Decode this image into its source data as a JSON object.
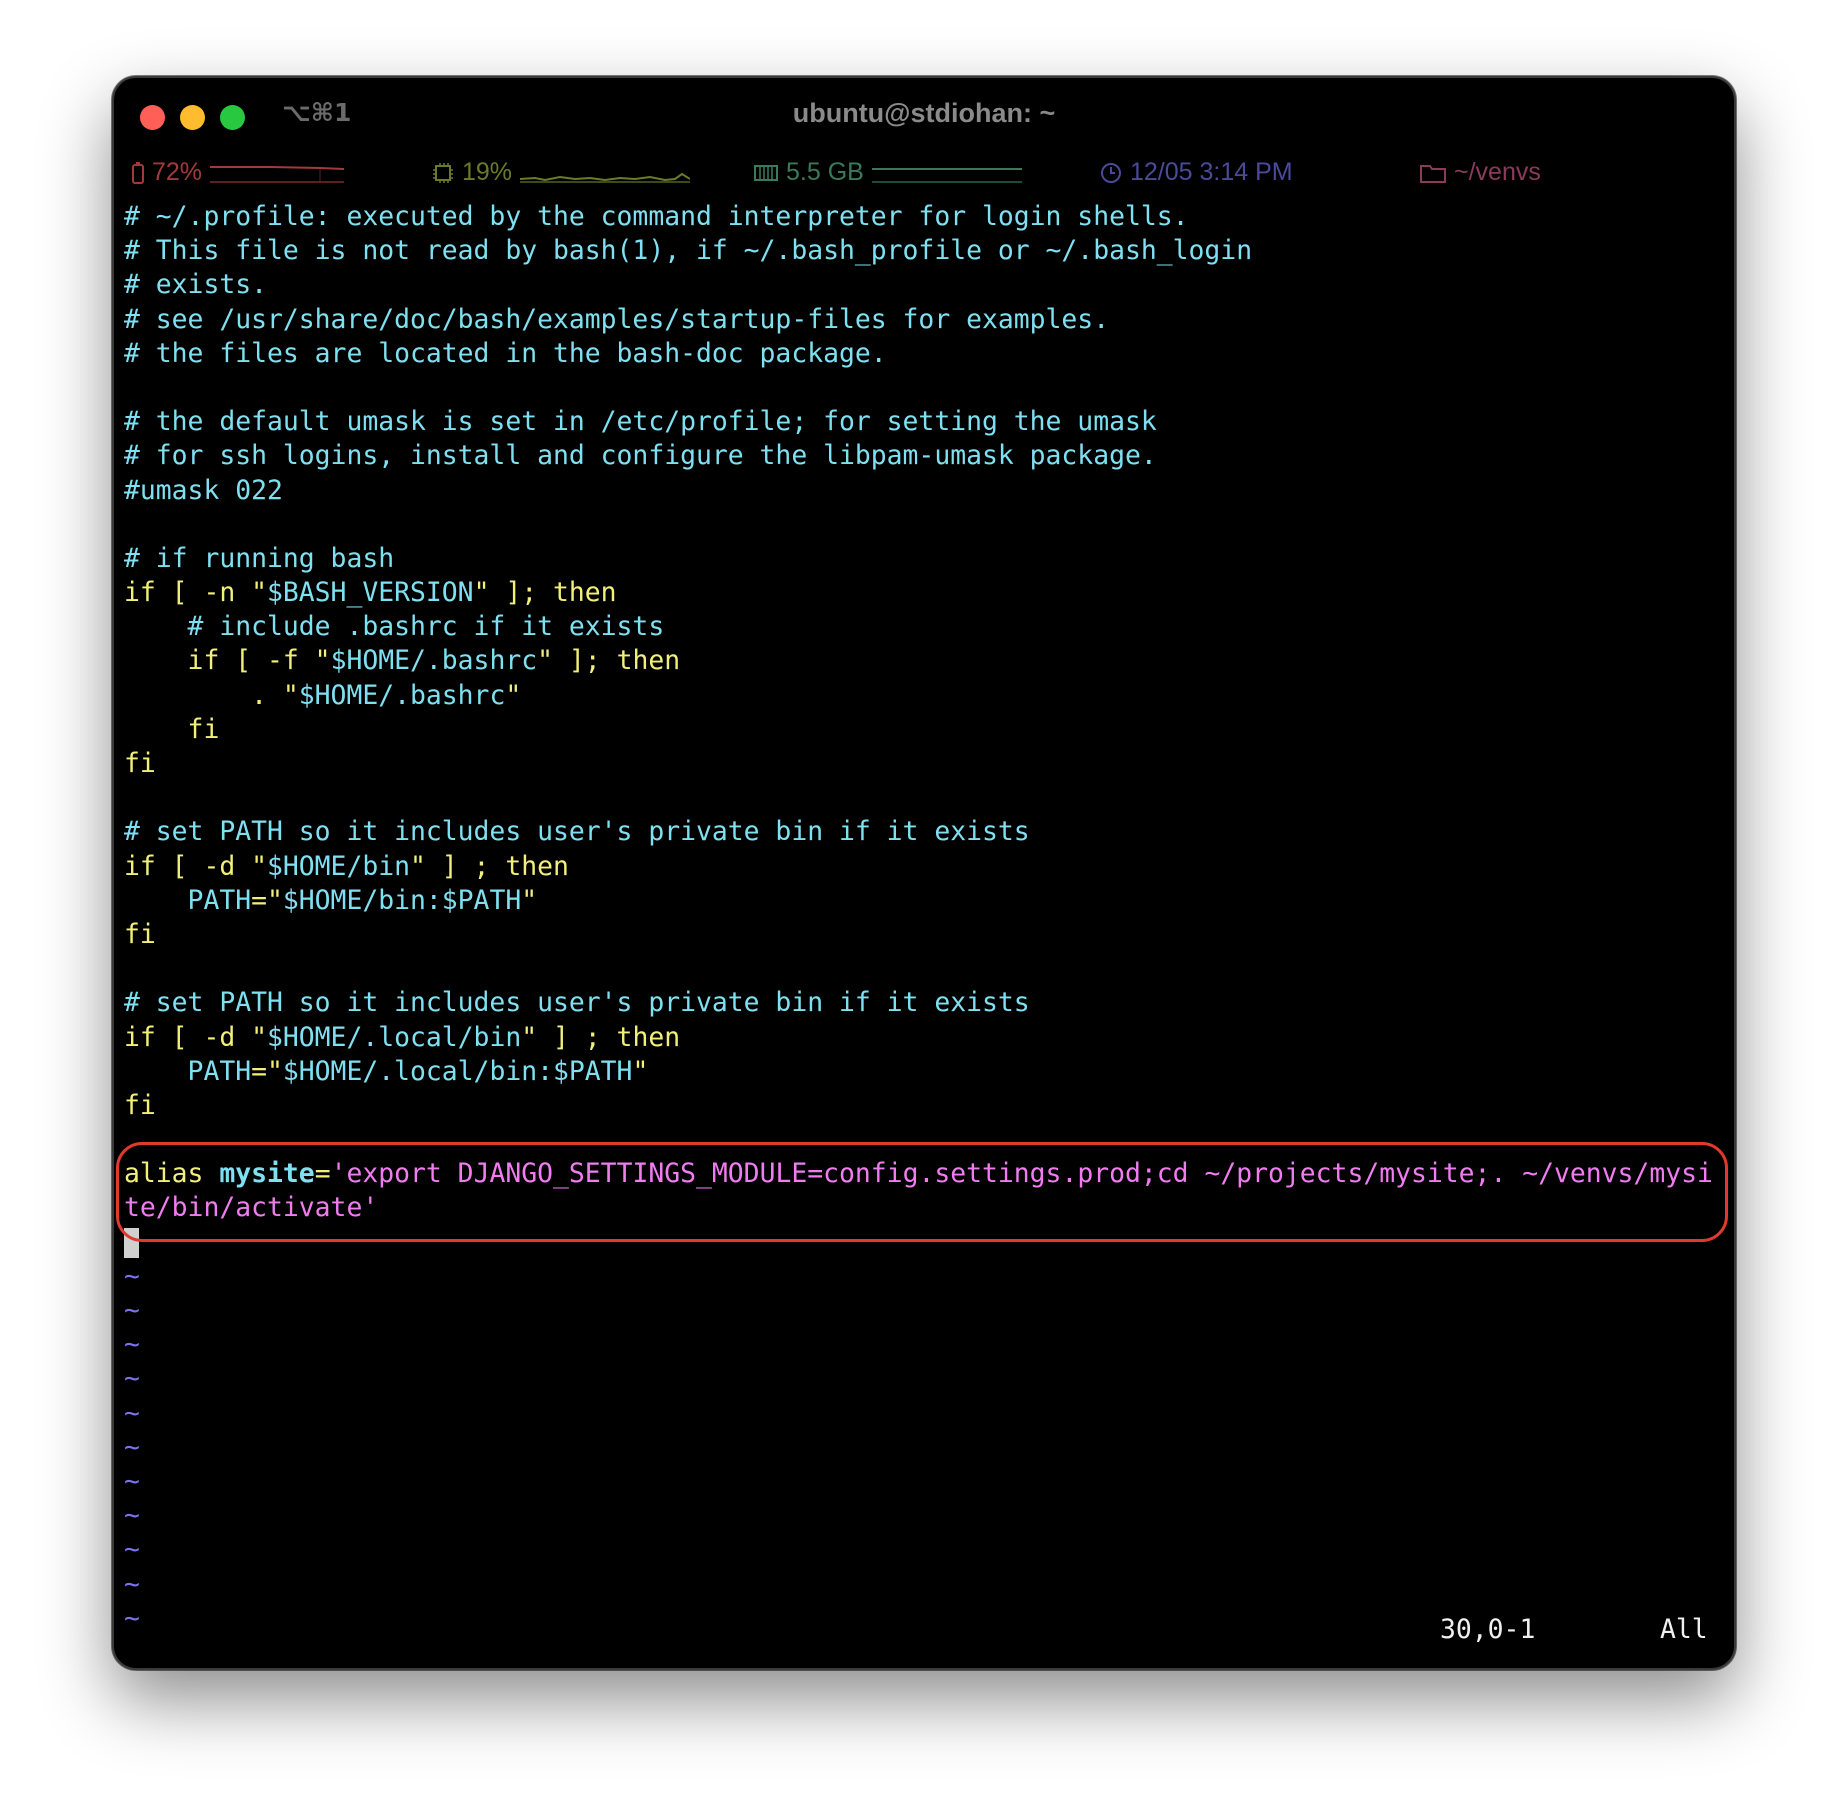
{
  "window": {
    "shortcut": "⌥⌘1",
    "title": "ubuntu@stdiohan: ~"
  },
  "statusbar": {
    "battery": {
      "value": "72%",
      "icon": "battery-icon",
      "color": "#a33a3a"
    },
    "cpu": {
      "value": "19%",
      "icon": "cpu-icon",
      "color": "#6b7a2a"
    },
    "memory": {
      "value": "5.5 GB",
      "icon": "memory-icon",
      "color": "#3a7a5a"
    },
    "clock": {
      "value": "12/05 3:14 PM",
      "icon": "clock-icon",
      "color": "#4a4a9a"
    },
    "dir": {
      "value": "~/venvs",
      "icon": "folder-icon",
      "color": "#8a3a5a"
    }
  },
  "editor": {
    "lines": [
      {
        "type": "comment",
        "text": "# ~/.profile: executed by the command interpreter for login shells."
      },
      {
        "type": "comment",
        "text": "# This file is not read by bash(1), if ~/.bash_profile or ~/.bash_login"
      },
      {
        "type": "comment",
        "text": "# exists."
      },
      {
        "type": "comment",
        "text": "# see /usr/share/doc/bash/examples/startup-files for examples."
      },
      {
        "type": "comment",
        "text": "# the files are located in the bash-doc package."
      },
      {
        "type": "blank",
        "text": ""
      },
      {
        "type": "comment",
        "text": "# the default umask is set in /etc/profile; for setting the umask"
      },
      {
        "type": "comment",
        "text": "# for ssh logins, install and configure the libpam-umask package."
      },
      {
        "type": "comment",
        "text": "#umask 022"
      },
      {
        "type": "blank",
        "text": ""
      },
      {
        "type": "comment",
        "text": "# if running bash"
      },
      {
        "type": "code",
        "parts": [
          {
            "c": "kw",
            "t": "if [ -n \""
          },
          {
            "c": "str",
            "t": "$BASH_VERSION"
          },
          {
            "c": "kw",
            "t": "\" ]; then"
          }
        ]
      },
      {
        "type": "comment",
        "text": "    # include .bashrc if it exists"
      },
      {
        "type": "code",
        "parts": [
          {
            "c": "kw",
            "t": "    if [ -f \""
          },
          {
            "c": "str",
            "t": "$HOME/.bashrc"
          },
          {
            "c": "kw",
            "t": "\" ]; then"
          }
        ]
      },
      {
        "type": "code",
        "parts": [
          {
            "c": "kw",
            "t": "        . \""
          },
          {
            "c": "str",
            "t": "$HOME/.bashrc"
          },
          {
            "c": "kw",
            "t": "\""
          }
        ]
      },
      {
        "type": "code",
        "parts": [
          {
            "c": "kw",
            "t": "    fi"
          }
        ]
      },
      {
        "type": "code",
        "parts": [
          {
            "c": "kw",
            "t": "fi"
          }
        ]
      },
      {
        "type": "blank",
        "text": ""
      },
      {
        "type": "comment",
        "text": "# set PATH so it includes user's private bin if it exists"
      },
      {
        "type": "code",
        "parts": [
          {
            "c": "kw",
            "t": "if [ -d \""
          },
          {
            "c": "str",
            "t": "$HOME/bin"
          },
          {
            "c": "kw",
            "t": "\" ] ; then"
          }
        ]
      },
      {
        "type": "code",
        "parts": [
          {
            "c": "str",
            "t": "    PATH"
          },
          {
            "c": "kw",
            "t": "=\""
          },
          {
            "c": "str",
            "t": "$HOME/bin:$PATH"
          },
          {
            "c": "kw",
            "t": "\""
          }
        ]
      },
      {
        "type": "code",
        "parts": [
          {
            "c": "kw",
            "t": "fi"
          }
        ]
      },
      {
        "type": "blank",
        "text": ""
      },
      {
        "type": "comment",
        "text": "# set PATH so it includes user's private bin if it exists"
      },
      {
        "type": "code",
        "parts": [
          {
            "c": "kw",
            "t": "if [ -d \""
          },
          {
            "c": "str",
            "t": "$HOME/.local/bin"
          },
          {
            "c": "kw",
            "t": "\" ] ; then"
          }
        ]
      },
      {
        "type": "code",
        "parts": [
          {
            "c": "str",
            "t": "    PATH"
          },
          {
            "c": "kw",
            "t": "=\""
          },
          {
            "c": "str",
            "t": "$HOME/.local/bin:$PATH"
          },
          {
            "c": "kw",
            "t": "\""
          }
        ]
      },
      {
        "type": "code",
        "parts": [
          {
            "c": "kw",
            "t": "fi"
          }
        ]
      },
      {
        "type": "blank",
        "text": ""
      }
    ],
    "alias": {
      "keyword": "alias ",
      "name": "mysite",
      "eq": "=",
      "value_line1": "'export DJANGO_SETTINGS_MODULE=config.settings.prod;cd ~/projects/mysite;. ~/venvs/mysi",
      "value_line2": "te/bin/activate'"
    },
    "tilde_lines": [
      "~",
      "~",
      "~",
      "~",
      "~",
      "~",
      "~",
      "~",
      "~",
      "~",
      "~"
    ],
    "ruler": {
      "position": "30,0-1",
      "scroll": "All"
    }
  }
}
